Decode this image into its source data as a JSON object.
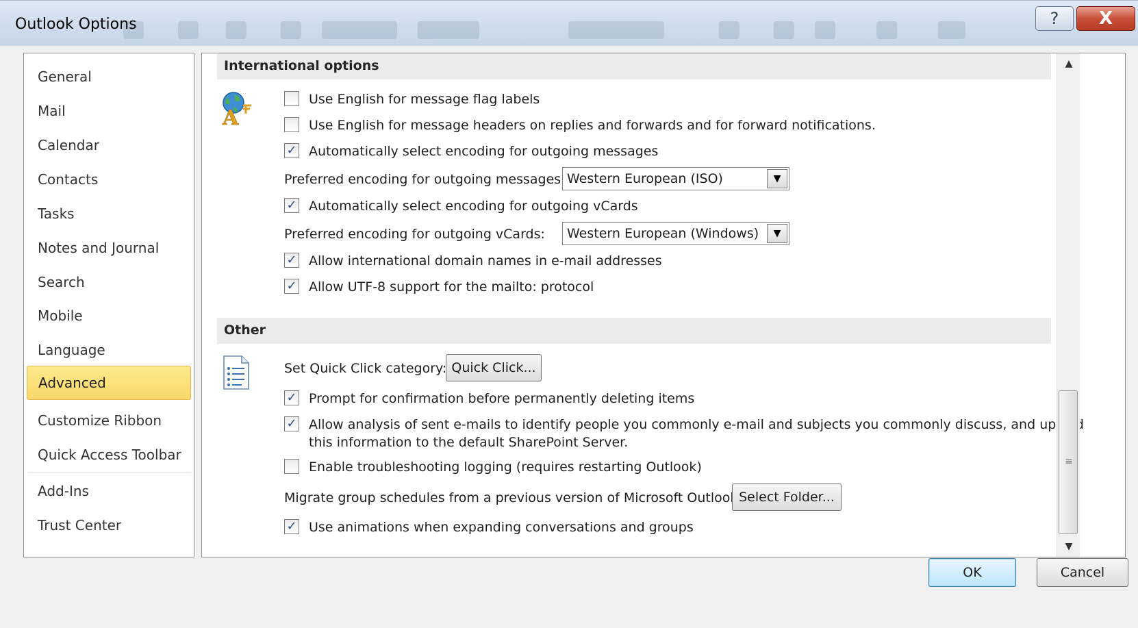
{
  "window": {
    "title": "Outlook Options",
    "help_label": "?",
    "close_label": "X"
  },
  "nav": {
    "items": [
      {
        "label": "General"
      },
      {
        "label": "Mail"
      },
      {
        "label": "Calendar"
      },
      {
        "label": "Contacts"
      },
      {
        "label": "Tasks"
      },
      {
        "label": "Notes and Journal"
      },
      {
        "label": "Search"
      },
      {
        "label": "Mobile"
      },
      {
        "label": "Language"
      },
      {
        "label": "Advanced",
        "selected": true
      },
      {
        "label": "Customize Ribbon"
      },
      {
        "label": "Quick Access Toolbar"
      },
      {
        "label": "Add-Ins"
      },
      {
        "label": "Trust Center"
      }
    ]
  },
  "international": {
    "header": "International options",
    "icon": "globe-letter-icon",
    "english_flag_labels": {
      "label": "Use English for message flag labels",
      "checked": false
    },
    "english_headers": {
      "label": "Use English for message headers on replies and forwards and for forward notifications.",
      "checked": false
    },
    "auto_encoding_messages": {
      "label": "Automatically select encoding for outgoing messages",
      "checked": true
    },
    "preferred_encoding_messages": {
      "label": "Preferred encoding for outgoing messages:",
      "value": "Western European (ISO)"
    },
    "auto_encoding_vcards": {
      "label": "Automatically select encoding for outgoing vCards",
      "checked": true
    },
    "preferred_encoding_vcards": {
      "label": "Preferred encoding for outgoing vCards:",
      "value": "Western European (Windows)"
    },
    "idn_addresses": {
      "label": "Allow international domain names in e-mail addresses",
      "checked": true
    },
    "utf8_mailto": {
      "label": "Allow UTF-8 support for the mailto: protocol",
      "checked": true
    }
  },
  "other": {
    "header": "Other",
    "icon": "list-document-icon",
    "quick_click_label": "Set Quick Click category:",
    "quick_click_button": "Quick Click...",
    "confirm_delete": {
      "label": "Prompt for confirmation before permanently deleting items",
      "checked": true
    },
    "analysis": {
      "label_line1": "Allow analysis of sent e-mails to identify people you commonly e-mail and subjects you commonly discuss, and upload",
      "label_line2": "this information to the default SharePoint Server.",
      "checked": true
    },
    "troubleshooting": {
      "label": "Enable troubleshooting logging (requires restarting Outlook)",
      "checked": false
    },
    "migrate_label": "Migrate group schedules from a previous version of Microsoft Outlook:",
    "select_folder_button": "Select Folder...",
    "animations": {
      "label": "Use animations when expanding conversations and groups",
      "checked": true
    }
  },
  "footer": {
    "ok": "OK",
    "cancel": "Cancel"
  },
  "glyphs": {
    "check": "✓",
    "dropdown": "▼",
    "scroll_up": "▲",
    "scroll_down": "▼",
    "grip": "≡"
  }
}
